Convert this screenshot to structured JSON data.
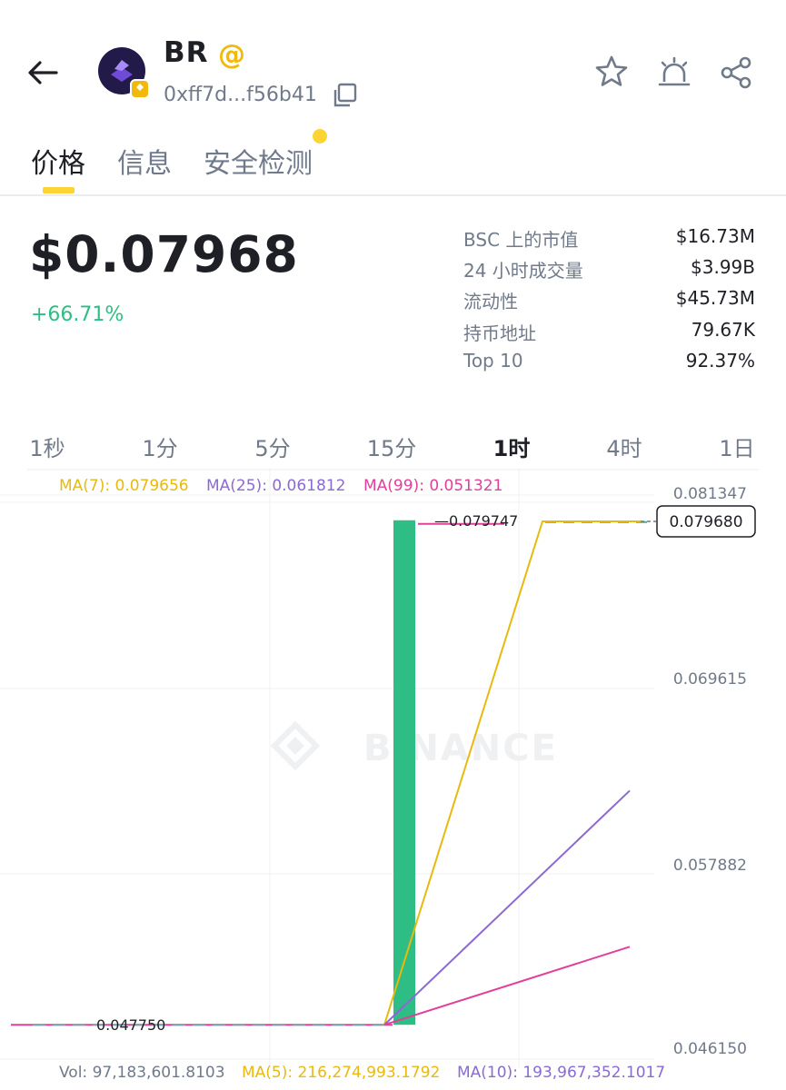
{
  "header": {
    "token": "BR",
    "address": "0xff7d...f56b41"
  },
  "tabs": [
    "价格",
    "信息",
    "安全检测"
  ],
  "price": {
    "value": "$0.07968",
    "change": "+66.71%"
  },
  "stats": [
    {
      "label": "BSC 上的市值",
      "value": "$16.73M"
    },
    {
      "label": "24 小时成交量",
      "value": "$3.99B"
    },
    {
      "label": "流动性",
      "value": "$45.73M"
    },
    {
      "label": "持币地址",
      "value": "79.67K"
    },
    {
      "label": "Top 10",
      "value": "92.37%"
    }
  ],
  "timeframes": [
    "1秒",
    "1分",
    "5分",
    "15分",
    "1时",
    "4时",
    "1日"
  ],
  "active_timeframe": "1时",
  "ma_price": {
    "ma7": "MA(7): 0.079656",
    "ma25": "MA(25): 0.061812",
    "ma99": "MA(99): 0.051321"
  },
  "vol": {
    "vol": "Vol: 97,183,601.8103",
    "ma5": "MA(5): 216,274,993.1792",
    "ma10": "MA(10): 193,967,352.1017"
  },
  "watermark": "BINANCE",
  "colors": {
    "accent": "#fcd535",
    "up": "#2ebd85",
    "ma7": "#e8b90e",
    "ma25": "#8a6ad3",
    "ma99": "#e0409a"
  },
  "chart_data": {
    "type": "candlestick",
    "y_axis_labels": [
      "0.081347",
      "0.069615",
      "0.057882",
      "0.046150"
    ],
    "ylim": [
      0.04615,
      0.081347
    ],
    "current_price_label": "0.079680",
    "annotations": {
      "high": "0.079747",
      "low": "0.047750"
    },
    "candles": [
      {
        "open": 0.04775,
        "close": 0.079747,
        "high": 0.079747,
        "low": 0.04775,
        "color": "up"
      }
    ],
    "ma_lines": [
      {
        "name": "MA(7)",
        "start": 0.04775,
        "end": 0.07968
      },
      {
        "name": "MA(25)",
        "start": 0.04775,
        "end": 0.0626
      },
      {
        "name": "MA(99)",
        "start": 0.04775,
        "end": 0.0527
      }
    ],
    "grid": true
  }
}
